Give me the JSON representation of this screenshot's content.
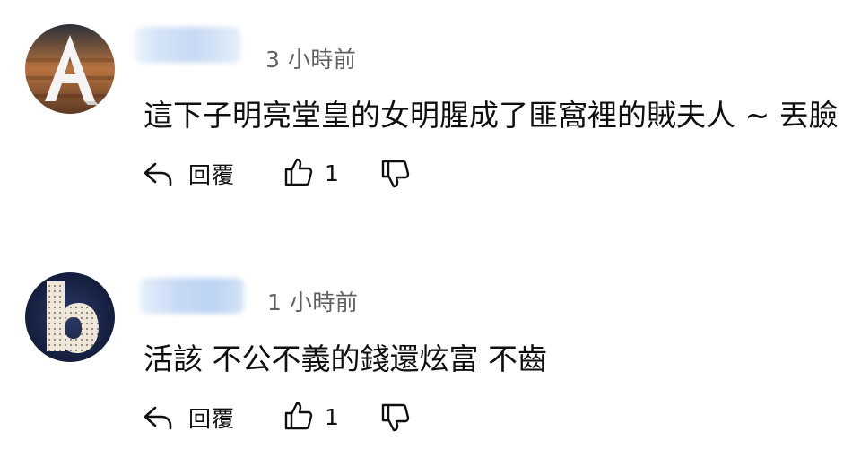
{
  "comments": [
    {
      "avatar_letter": "A",
      "timestamp": "3 小時前",
      "text": "這下子明亮堂皇的女明腥成了匪窩裡的賊夫人 ~ 丟臉",
      "reply_label": "回覆",
      "like_count": "1"
    },
    {
      "avatar_letter": "b",
      "timestamp": "1 小時前",
      "text": "活該 不公不義的錢還炫富 不齒",
      "reply_label": "回覆",
      "like_count": "1"
    }
  ],
  "icons": {
    "reply": "reply-arrow-icon",
    "like": "thumbs-up-icon",
    "dislike": "thumbs-down-icon"
  },
  "colors": {
    "text": "#0f0f0f",
    "timestamp": "#606060",
    "blurred_name": "#c9dcf5"
  }
}
